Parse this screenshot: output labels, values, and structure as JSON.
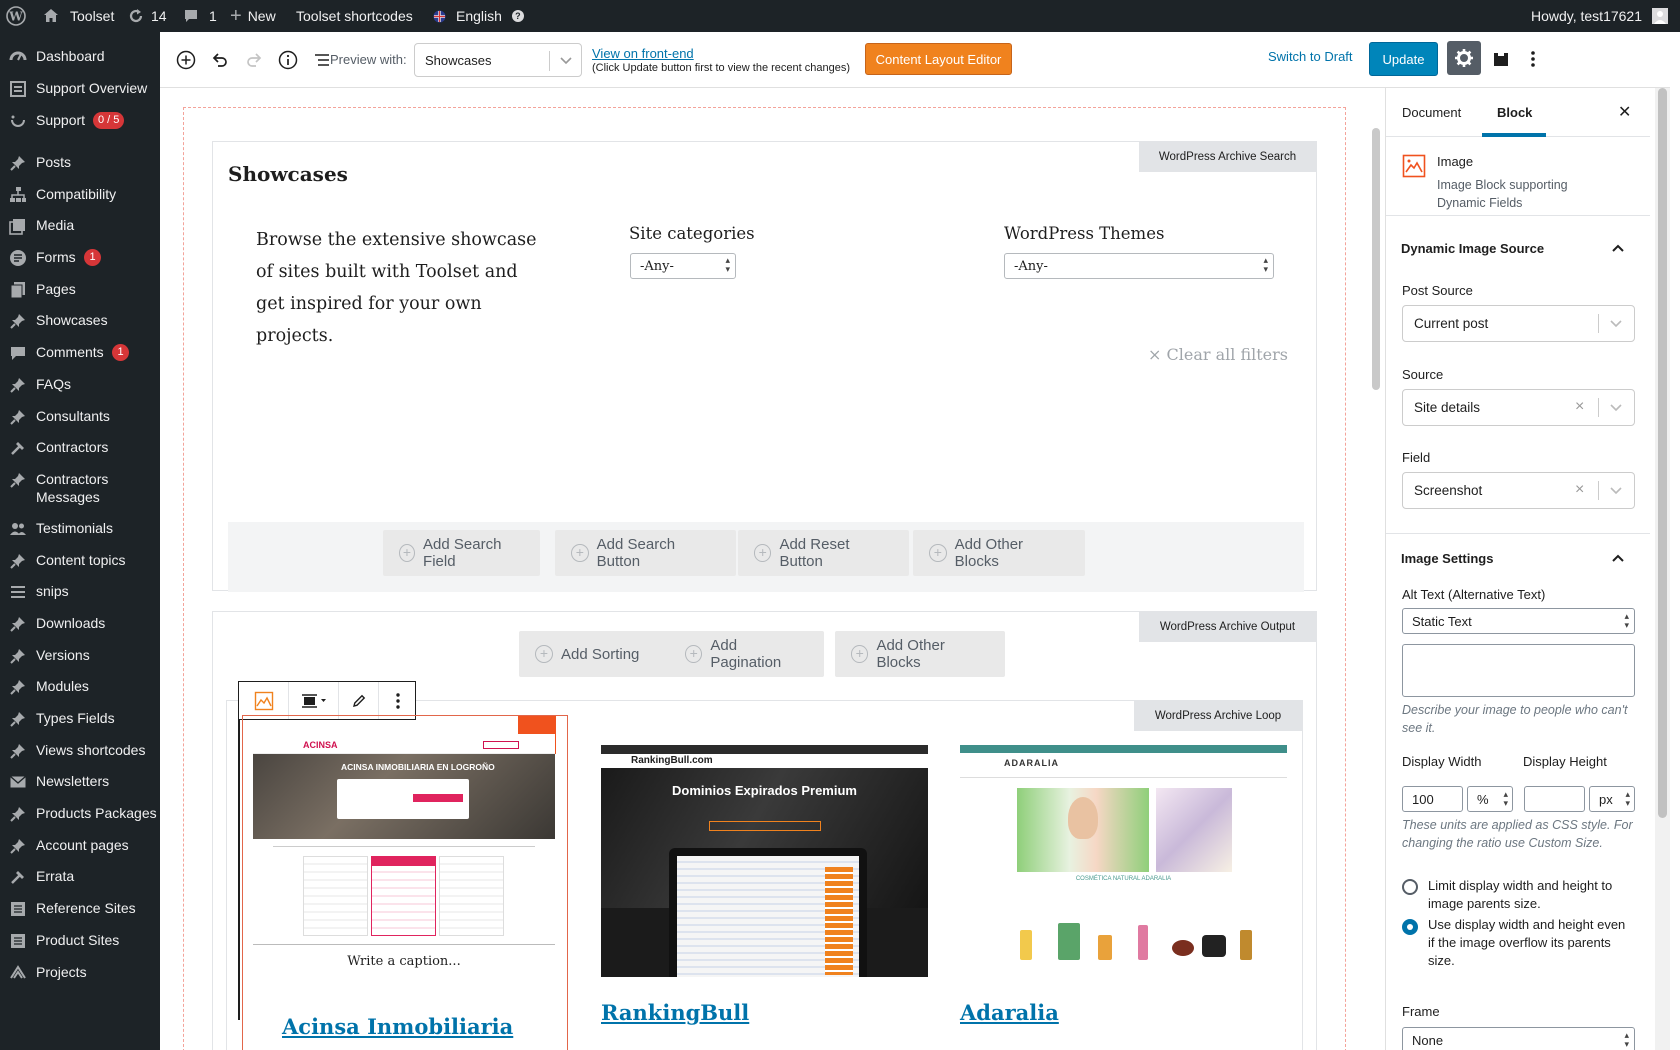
{
  "admin_bar": {
    "site_name": "Toolset",
    "updates_count": "14",
    "comments_count": "1",
    "new_label": "New",
    "shortcodes_label": "Toolset shortcodes",
    "language": "English",
    "howdy": "Howdy, test17621"
  },
  "sidebar": {
    "items": [
      {
        "label": "Dashboard",
        "icon": "dashboard-icon"
      },
      {
        "label": "Support Overview",
        "icon": "overview-icon"
      },
      {
        "label": "Support",
        "icon": "support-icon",
        "badge": "0 / 5"
      },
      {
        "label": "Posts",
        "icon": "pin-icon"
      },
      {
        "label": "Compatibility",
        "icon": "sitemap-icon"
      },
      {
        "label": "Media",
        "icon": "media-icon"
      },
      {
        "label": "Forms",
        "icon": "forms-icon",
        "badge": "1"
      },
      {
        "label": "Pages",
        "icon": "pages-icon"
      },
      {
        "label": "Showcases",
        "icon": "pin-icon"
      },
      {
        "label": "Comments",
        "icon": "comment-icon",
        "badge": "1"
      },
      {
        "label": "FAQs",
        "icon": "pin-icon"
      },
      {
        "label": "Consultants",
        "icon": "pin-icon"
      },
      {
        "label": "Contractors",
        "icon": "hammer-icon"
      },
      {
        "label": "Contractors Messages",
        "icon": "pin-icon"
      },
      {
        "label": "Testimonials",
        "icon": "users-icon"
      },
      {
        "label": "Content topics",
        "icon": "pin-icon"
      },
      {
        "label": "snips",
        "icon": "list-icon"
      },
      {
        "label": "Downloads",
        "icon": "pin-icon"
      },
      {
        "label": "Versions",
        "icon": "pin-icon"
      },
      {
        "label": "Modules",
        "icon": "pin-icon"
      },
      {
        "label": "Types Fields",
        "icon": "pin-icon"
      },
      {
        "label": "Views shortcodes",
        "icon": "pin-icon"
      },
      {
        "label": "Newsletters",
        "icon": "mail-icon"
      },
      {
        "label": "Products Packages",
        "icon": "pin-icon"
      },
      {
        "label": "Account pages",
        "icon": "pin-icon"
      },
      {
        "label": "Errata",
        "icon": "hammer-icon"
      },
      {
        "label": "Reference Sites",
        "icon": "reference-icon"
      },
      {
        "label": "Product Sites",
        "icon": "reference-icon"
      },
      {
        "label": "Projects",
        "icon": "projects-icon"
      }
    ]
  },
  "toolbar": {
    "preview_label": "Preview with:",
    "preview_value": "Showcases",
    "view_frontend": "View on front-end",
    "view_note": "(Click Update button first to view the recent changes)",
    "layout_editor": "Content Layout Editor",
    "switch_draft": "Switch to Draft",
    "update": "Update"
  },
  "editor": {
    "search_tag": "WordPress Archive Search",
    "title": "Showcases",
    "intro": "Browse the extensive showcase of sites built with Toolset and get inspired for your own projects.",
    "site_categories_label": "Site categories",
    "site_categories_value": "-Any-",
    "themes_label": "WordPress Themes",
    "themes_value": "-Any-",
    "clear_filters": "× Clear all filters",
    "search_buttons": [
      "Add Search Field",
      "Add Search Button",
      "Add Reset Button",
      "Add Other Blocks"
    ],
    "output_tag": "WordPress Archive Output",
    "output_buttons": [
      "Add Sorting",
      "Add Pagination",
      "Add Other Blocks"
    ],
    "loop_tag": "WordPress Archive Loop",
    "caption_placeholder": "Write a caption...",
    "cards": [
      {
        "title": "Acinsa Inmobiliaria",
        "shot_headline": "ACINSA INMOBILIARIA EN LOGROÑO",
        "shot_brand": "ACINSA"
      },
      {
        "title": "RankingBull",
        "shot_headline": "Dominios Expirados Premium",
        "shot_brand": "RankingBull.com"
      },
      {
        "title": "Adaralia",
        "shot_headline": "COSMÉTICA NATURAL ADARALIA",
        "shot_brand": "ADARALIA"
      }
    ]
  },
  "panel": {
    "tabs": [
      "Document",
      "Block"
    ],
    "active_tab": "Block",
    "block_name": "Image",
    "block_desc": "Image Block supporting Dynamic Fields",
    "dynamic_source_title": "Dynamic Image Source",
    "post_source_label": "Post Source",
    "post_source_value": "Current post",
    "source_label": "Source",
    "source_value": "Site details",
    "field_label": "Field",
    "field_value": "Screenshot",
    "image_settings_title": "Image Settings",
    "alt_label": "Alt Text (Alternative Text)",
    "alt_value": "Static Text",
    "alt_help": "Describe your image to people who can't see it.",
    "width_label": "Display Width",
    "width_value": "100",
    "width_unit": "%",
    "height_label": "Display Height",
    "height_value": "",
    "height_unit": "px",
    "units_help": "These units are applied as CSS style. For changing the ratio use Custom Size.",
    "radio1": "Limit display width and height to image parents size.",
    "radio2": "Use display width and height even if the image overflow its parents size.",
    "radio_selected": 2,
    "frame_label": "Frame",
    "frame_value": "None"
  },
  "colors": {
    "accent": "#0073aa",
    "orange": "#f0821e",
    "adminbar": "#1d2327",
    "badge": "#d63638"
  }
}
